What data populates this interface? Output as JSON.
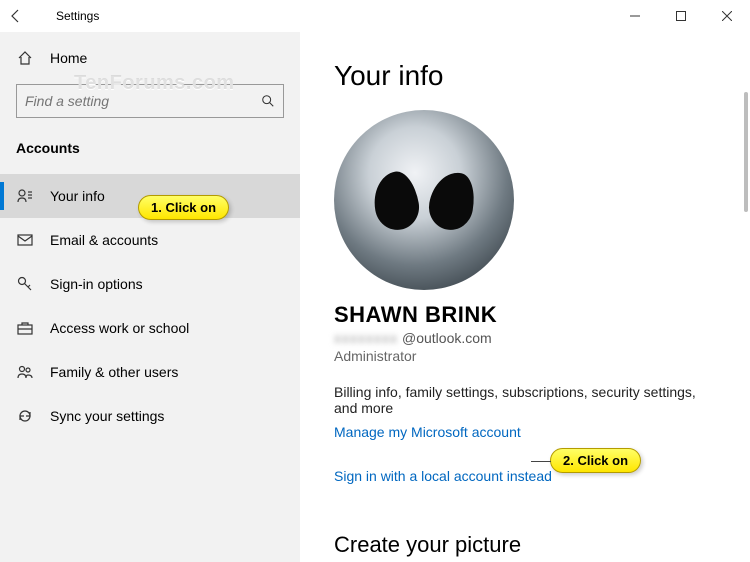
{
  "window": {
    "title": "Settings"
  },
  "sidebar": {
    "home": "Home",
    "search_placeholder": "Find a setting",
    "section": "Accounts",
    "items": [
      {
        "label": "Your info",
        "selected": true
      },
      {
        "label": "Email & accounts"
      },
      {
        "label": "Sign-in options"
      },
      {
        "label": "Access work or school"
      },
      {
        "label": "Family & other users"
      },
      {
        "label": "Sync your settings"
      }
    ]
  },
  "content": {
    "heading": "Your info",
    "user_name": "SHAWN BRINK",
    "email_domain": "@outlook.com",
    "role": "Administrator",
    "billing_desc": "Billing info, family settings, subscriptions, security settings, and more",
    "manage_link": "Manage my Microsoft account",
    "local_link": "Sign in with a local account instead",
    "picture_heading": "Create your picture"
  },
  "callouts": {
    "c1": "1. Click on",
    "c2": "2. Click on"
  },
  "watermark": "TenForums.com"
}
